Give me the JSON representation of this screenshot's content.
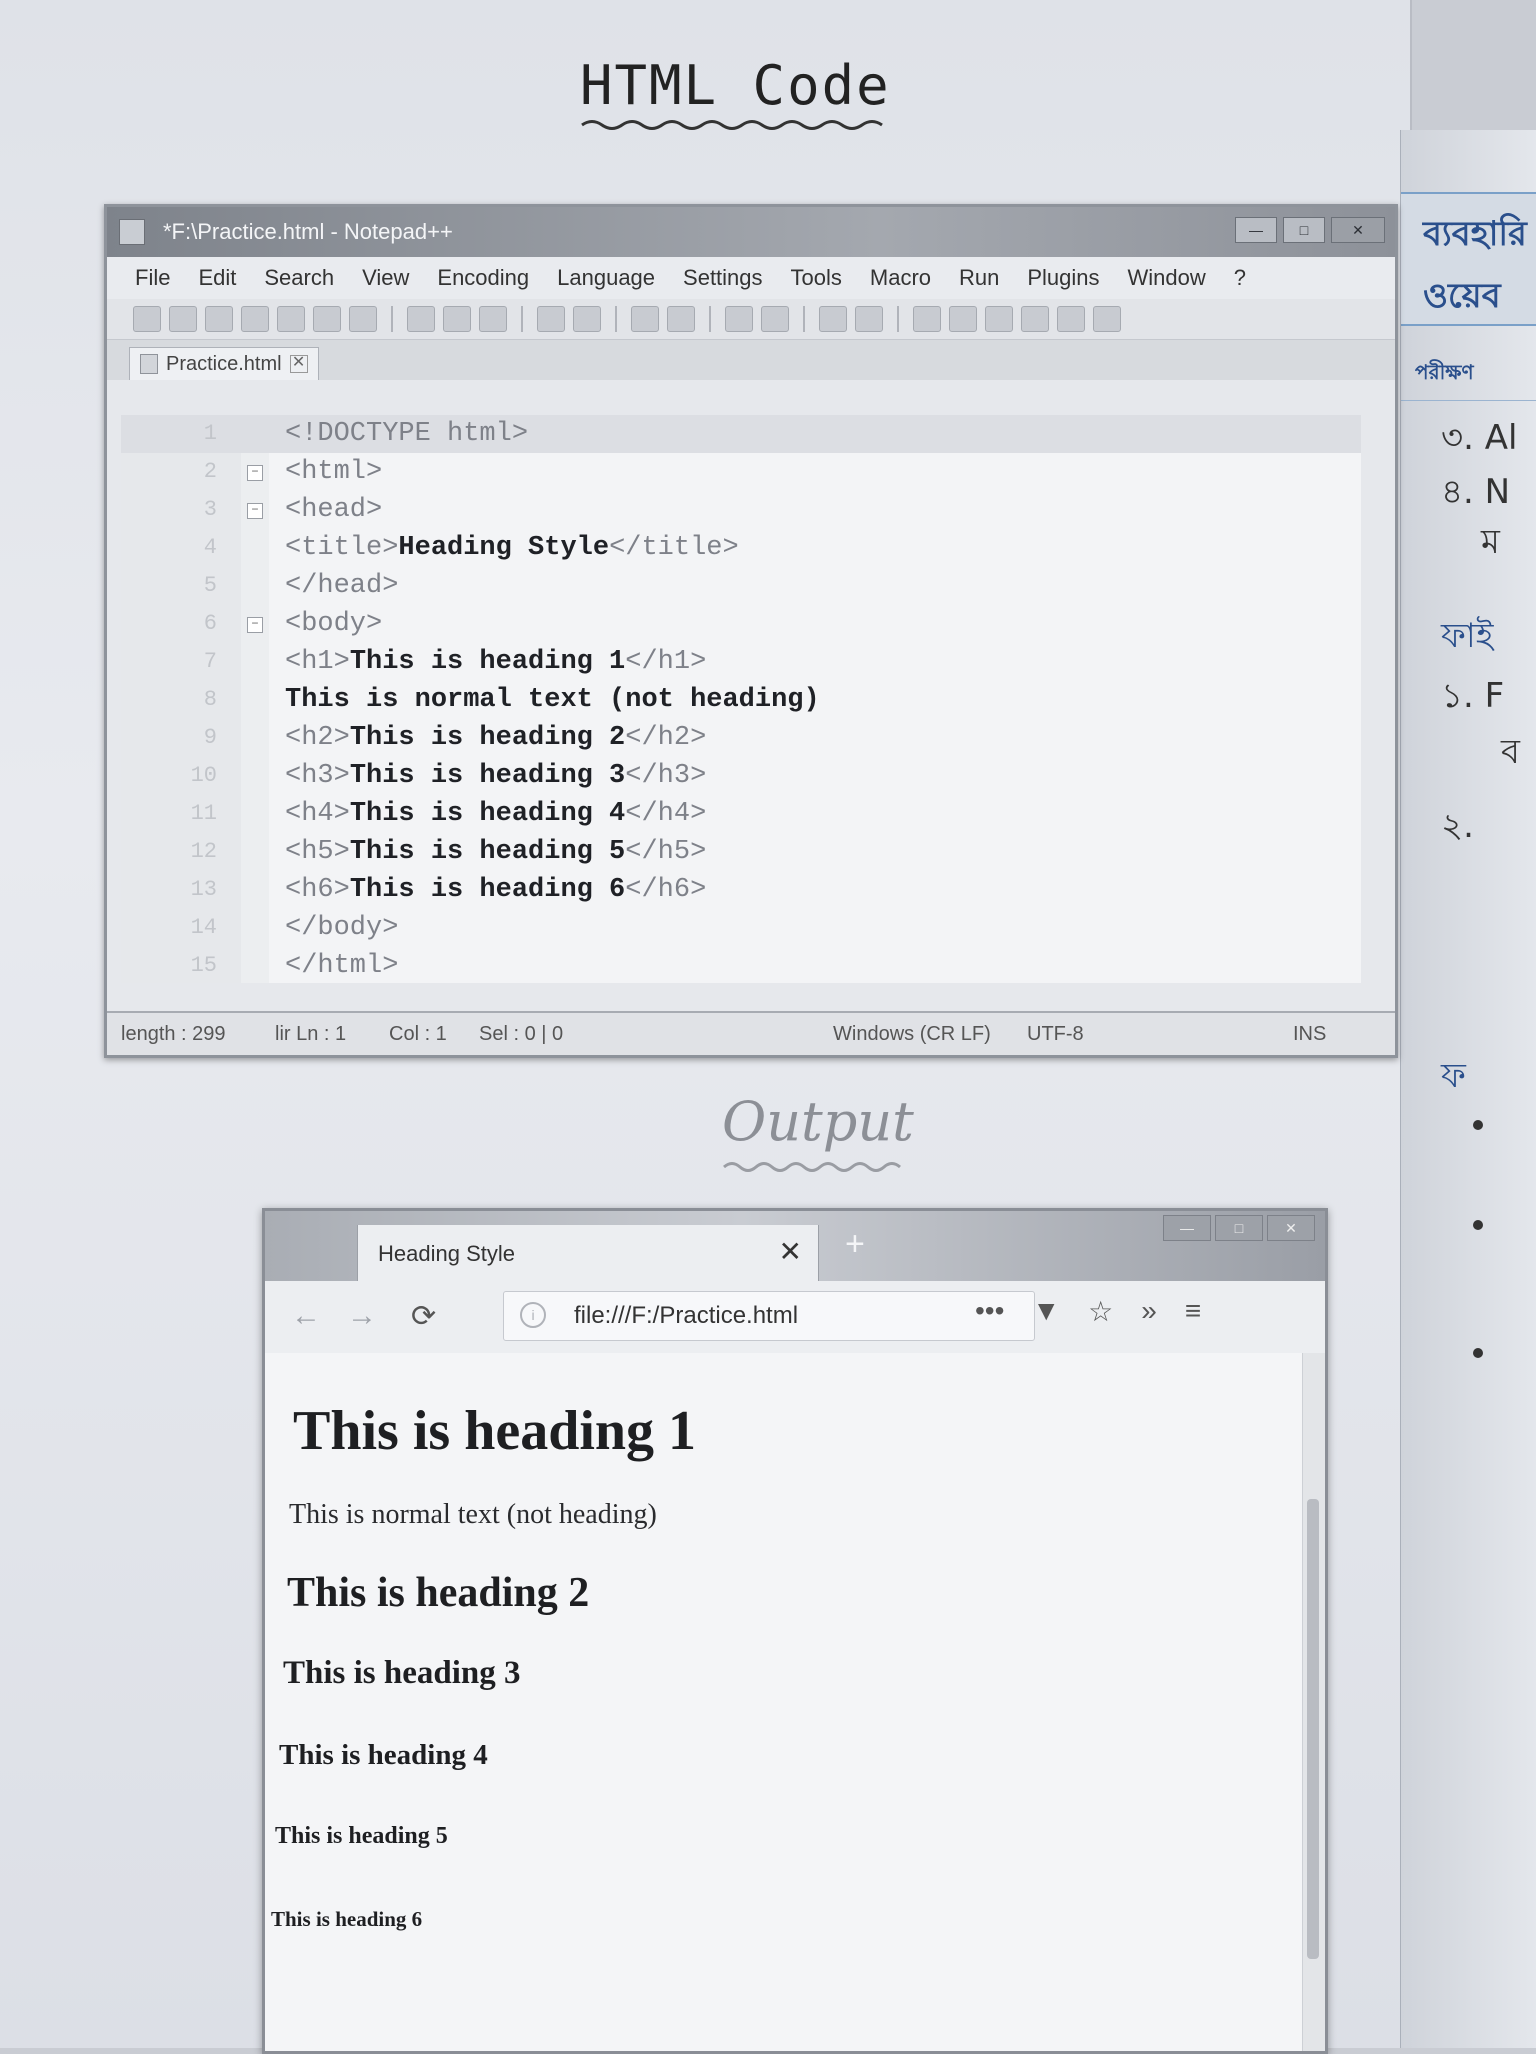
{
  "page_heading": "HTML Code",
  "output_heading": "Output",
  "side_page": {
    "band_line1": "ব্যবহারি",
    "band_line2": "ওয়েব",
    "sub": "পরীক্ষণ",
    "lines": [
      "৩. Al",
      "৪. N",
      "ম",
      "ফাই",
      "১. F",
      "ব",
      "২.",
      "ফ"
    ]
  },
  "notepad": {
    "title": "*F:\\Practice.html - Notepad++",
    "menu": [
      "File",
      "Edit",
      "Search",
      "View",
      "Encoding",
      "Language",
      "Settings",
      "Tools",
      "Macro",
      "Run",
      "Plugins",
      "Window",
      "?"
    ],
    "tab_label": "Practice.html",
    "close_glyph": "✕",
    "lines": [
      {
        "n": "1",
        "tag_open": "<!DOCTYPE html>",
        "text": "",
        "tag_close": ""
      },
      {
        "n": "2",
        "tag_open": "<html>",
        "text": "",
        "tag_close": ""
      },
      {
        "n": "3",
        "tag_open": "<head>",
        "text": "",
        "tag_close": ""
      },
      {
        "n": "4",
        "tag_open": "<title>",
        "text": "Heading Style",
        "tag_close": "</title>"
      },
      {
        "n": "5",
        "tag_open": "</head>",
        "text": "",
        "tag_close": ""
      },
      {
        "n": "6",
        "tag_open": "<body>",
        "text": "",
        "tag_close": ""
      },
      {
        "n": "7",
        "tag_open": "<h1>",
        "text": "This is heading 1",
        "tag_close": "</h1>"
      },
      {
        "n": "8",
        "tag_open": "",
        "text": "This is normal text (not heading)",
        "tag_close": ""
      },
      {
        "n": "9",
        "tag_open": "<h2>",
        "text": "This is heading 2",
        "tag_close": "</h2>"
      },
      {
        "n": "10",
        "tag_open": "<h3>",
        "text": "This is heading 3",
        "tag_close": "</h3>"
      },
      {
        "n": "11",
        "tag_open": "<h4>",
        "text": "This is heading 4",
        "tag_close": "</h4>"
      },
      {
        "n": "12",
        "tag_open": "<h5>",
        "text": "This is heading 5",
        "tag_close": "</h5>"
      },
      {
        "n": "13",
        "tag_open": "<h6>",
        "text": "This is heading 6",
        "tag_close": "</h6>"
      },
      {
        "n": "14",
        "tag_open": "</body>",
        "text": "",
        "tag_close": ""
      },
      {
        "n": "15",
        "tag_open": "</html>",
        "text": "",
        "tag_close": ""
      }
    ],
    "status": {
      "length": "length : 299",
      "position": "lir Ln : 1",
      "col": "Col : 1",
      "sel": "Sel : 0 | 0",
      "eol": "Windows (CR LF)",
      "encoding": "UTF-8",
      "mode": "INS"
    }
  },
  "browser": {
    "tab_title": "Heading Style",
    "tab_close": "✕",
    "new_tab": "+",
    "window_buttons": [
      "—",
      "□",
      "✕"
    ],
    "nav_icons": {
      "back": "←",
      "forward": "→",
      "reload": "⟳",
      "more": "•••",
      "star": "☆",
      "overflow": "»",
      "menu": "≡"
    },
    "url": "file:///F:/Practice.html",
    "h1": "This is heading 1",
    "paragraph": "This is normal text (not heading)",
    "h2": "This is heading 2",
    "h3": "This is heading 3",
    "h4": "This is heading 4",
    "h5": "This is heading 5",
    "h6": "This is heading 6"
  }
}
